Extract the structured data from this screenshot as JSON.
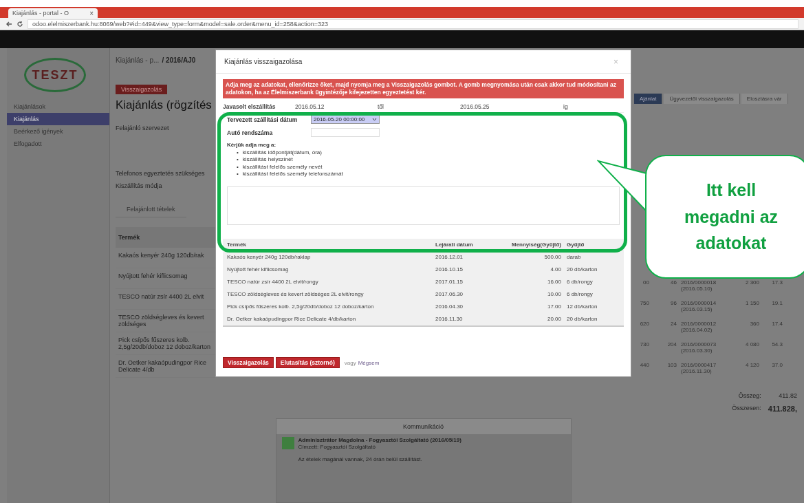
{
  "browser": {
    "tab_title": "Kiajánlás - portal - O",
    "close": "×",
    "url": "odoo.elelmiszerbank.hu:8069/web?#id=449&view_type=form&model=sale.order&menu_id=258&action=323"
  },
  "sidebar": {
    "logo": "TESZT",
    "items": [
      {
        "label": "Kiajánlások",
        "selected": false
      },
      {
        "label": "Kiajánlás",
        "selected": true
      },
      {
        "label": "Beérkező igények",
        "selected": false
      },
      {
        "label": "Elfogadott",
        "selected": false
      }
    ]
  },
  "page": {
    "breadcrumb": "Kiajánlás - p...",
    "breadcrumb_current": "/ 2016/AJ0",
    "confirm_button": "Visszaigazolás",
    "title": "Kiajánlás (rögzítés",
    "fields": [
      "Felajánló szervezet",
      "Telefonos egyeztetés szükséges",
      "Kiszállítás módja"
    ],
    "tab": "Felajánlott tételek",
    "table_header": "Termék",
    "rows": [
      "Kakaós kenyér 240g 120db/rak",
      "Nyújtott fehér kiflicsomag",
      "TESCO natúr zsír 4400 2L elvit",
      "TESCO zöldségleves és kevert\nzöldséges",
      "Pick csípős fűszeres kolb.\n2,5g/20db/doboz 12 doboz/karton",
      "Dr. Oetker kakaópudingpor Rice\nDelicate 4/db"
    ],
    "steps": [
      {
        "label": "Ajánlat",
        "selected": true
      },
      {
        "label": "Ügyvezetői visszaigazolás",
        "selected": false
      },
      {
        "label": "Elosztásra vár",
        "selected": false
      }
    ],
    "right_rows": [
      [
        "00",
        "46",
        "2016/0000018\n(2016.05.10)",
        "2 300",
        "17.3"
      ],
      [
        "750",
        "96",
        "2016/0000014\n(2016.03.15)",
        "1 150",
        "19.1"
      ],
      [
        "620",
        "24",
        "2016/0000012\n(2016.04.02)",
        "360",
        "17.4"
      ],
      [
        "730",
        "204",
        "2016/0000073\n(2016.03.30)",
        "4 080",
        "54.3"
      ],
      [
        "440",
        "103",
        "2016/0000417\n(2016.11.30)",
        "4 120",
        "37.0"
      ]
    ],
    "total_label": "Összeg:",
    "total": "411.82",
    "grand_label": "Összesen:",
    "grand": "411.828,"
  },
  "dialog": {
    "title": "Kiajánlás visszaigazolása",
    "close": "×",
    "alert": "Adja meg az adatokat, ellenőrizze őket, majd nyomja meg a Visszaigazolás gombot. A gomb megnyomása után csak akkor tud módosítani az adatokon, ha az Élelmiszerbank ügyintézője kifejezetten egyeztetést kér.",
    "suggested": {
      "label": "Javasolt elszállítás",
      "from": "2016.05.12",
      "from_suffix": "től",
      "to": "2016.05.25",
      "to_suffix": "ig"
    },
    "date_label": "Tervezett szállítási dátum",
    "date_value": "2016-05-20 00:00:00",
    "plate_label": "Autó rendszáma",
    "note_title": "Kérjük adja meg a:",
    "bullet": "•",
    "note_items": [
      "kiszállítás időpontját(dátum, óra)",
      "kiszállítás helyszínét",
      "kiszállítást felelős személy nevét",
      "kiszállítást felelős személy telefonszámát"
    ],
    "columns": [
      "Termék",
      "Lejárati dátum",
      "Mennyiség(Gyűjtő)",
      "Gyűjtő"
    ],
    "rows": [
      [
        "Kakaós kenyér 240g 120db/raklap",
        "2016.12.01",
        "500.00",
        "darab"
      ],
      [
        "Nyújtott fehér kiflicsomag",
        "2016.10.15",
        "4.00",
        "20 db/karton"
      ],
      [
        "TESCO natúr zsír 4400 2L elvit/rongy",
        "2017.01.15",
        "16.00",
        "6 db/rongy"
      ],
      [
        "TESCO zöldségleves és kevert zöldséges 2L elvit/rongy",
        "2017.06.30",
        "10.00",
        "6 db/rongy"
      ],
      [
        "Pick csípős fűszeres kolb. 2,5g/20db/doboz 12 doboz/karton",
        "2016.04.30",
        "17.00",
        "12 db/karton"
      ],
      [
        "Dr. Oetker kakaópudingpor Rice Delicate 4/db/karton",
        "2016.11.30",
        "20.00",
        "20 db/karton"
      ]
    ],
    "primary": "Visszaigazolás",
    "reject": "Elutasítás (sztornó)",
    "or": "vagy",
    "cancel": "Mégsem"
  },
  "chatter": {
    "title": "Kommunikáció",
    "author": "Adminisztrátor Magdolna - Fogyasztói Szolgáltató (2016/05/19)",
    "subtitle": "Címzett: Fogyasztói Szolgáltató",
    "message": "Az ételek magánál vannak, 24 órán belül szállítást."
  },
  "callout": {
    "text": "Itt kell megadni az adatokat"
  }
}
